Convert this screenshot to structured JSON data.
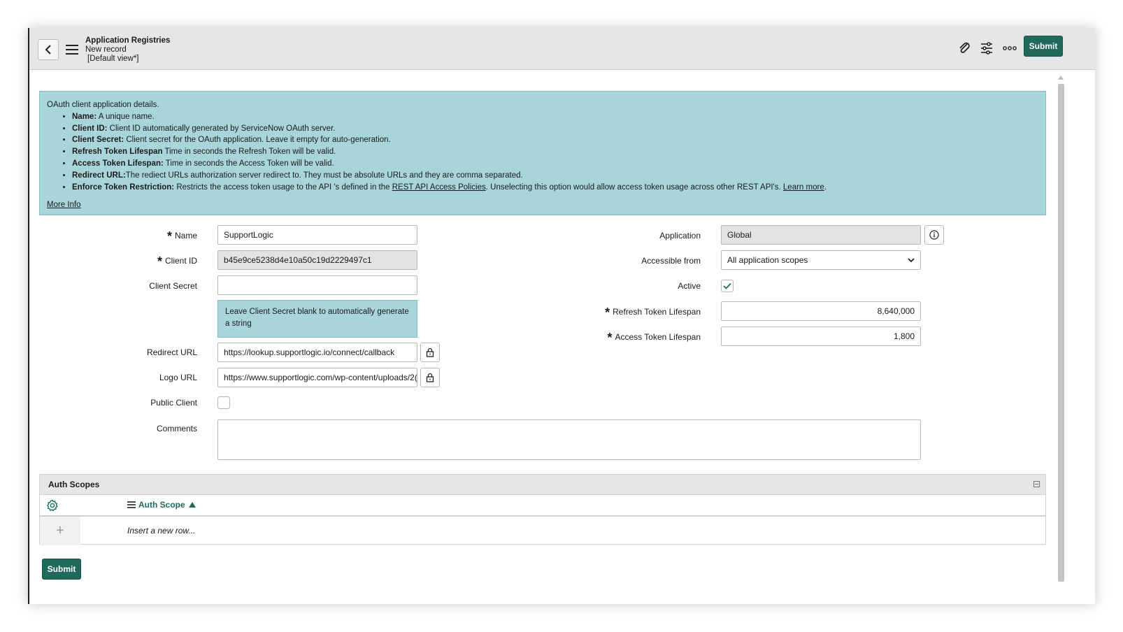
{
  "header": {
    "title": "Application Registries",
    "subtitle": "New record",
    "view": "[Default view*]",
    "submit_label": "Submit"
  },
  "info": {
    "intro": "OAuth client application details.",
    "items": [
      {
        "term": "Name:",
        "text": " A unique name."
      },
      {
        "term": "Client ID:",
        "text": " Client ID automatically generated by ServiceNow OAuth server."
      },
      {
        "term": "Client Secret:",
        "text": " Client secret for the OAuth application. Leave it empty for auto-generation."
      },
      {
        "term": "Refresh Token Lifespan",
        "text": " Time in seconds the Refresh Token will be valid."
      },
      {
        "term": "Access Token Lifespan:",
        "text": " Time in seconds the Access Token will be valid."
      },
      {
        "term": "Redirect URL:",
        "text": "The rediect URLs authorization server redirect to. They must be absolute URLs and they are comma separated."
      }
    ],
    "enforce": {
      "term": "Enforce Token Restriction:",
      "text_a": " Restricts the access token usage to the API 's defined in the ",
      "link1": "REST API Access Policies",
      "text_b": ". Unselecting this option would allow access token usage across other REST API's. ",
      "link2": "Learn more",
      "text_c": "."
    },
    "more_info": "More Info"
  },
  "form": {
    "name_label": "Name",
    "name_value": "SupportLogic",
    "client_id_label": "Client ID",
    "client_id_value": "b45e9ce5238d4e10a50c19d2229497c1",
    "client_secret_label": "Client Secret",
    "client_secret_value": "",
    "client_secret_hint": "Leave Client Secret blank to automatically generate a string",
    "redirect_url_label": "Redirect URL",
    "redirect_url_value": "https://lookup.supportlogic.io/connect/callback",
    "logo_url_label": "Logo URL",
    "logo_url_value": "https://www.supportlogic.com/wp-content/uploads/2(",
    "public_client_label": "Public Client",
    "comments_label": "Comments",
    "application_label": "Application",
    "application_value": "Global",
    "accessible_from_label": "Accessible from",
    "accessible_from_value": "All application scopes",
    "active_label": "Active",
    "refresh_label": "Refresh Token Lifespan",
    "refresh_value": "8,640,000",
    "access_label": "Access Token Lifespan",
    "access_value": "1,800"
  },
  "auth_scopes": {
    "title": "Auth Scopes",
    "column": "Auth Scope",
    "insert_row": "Insert a new row..."
  },
  "footer": {
    "submit_label": "Submit"
  },
  "colors": {
    "accent": "#1f6a5a",
    "info_bg": "#a8d5da",
    "header_bg": "#e4e6e7"
  }
}
